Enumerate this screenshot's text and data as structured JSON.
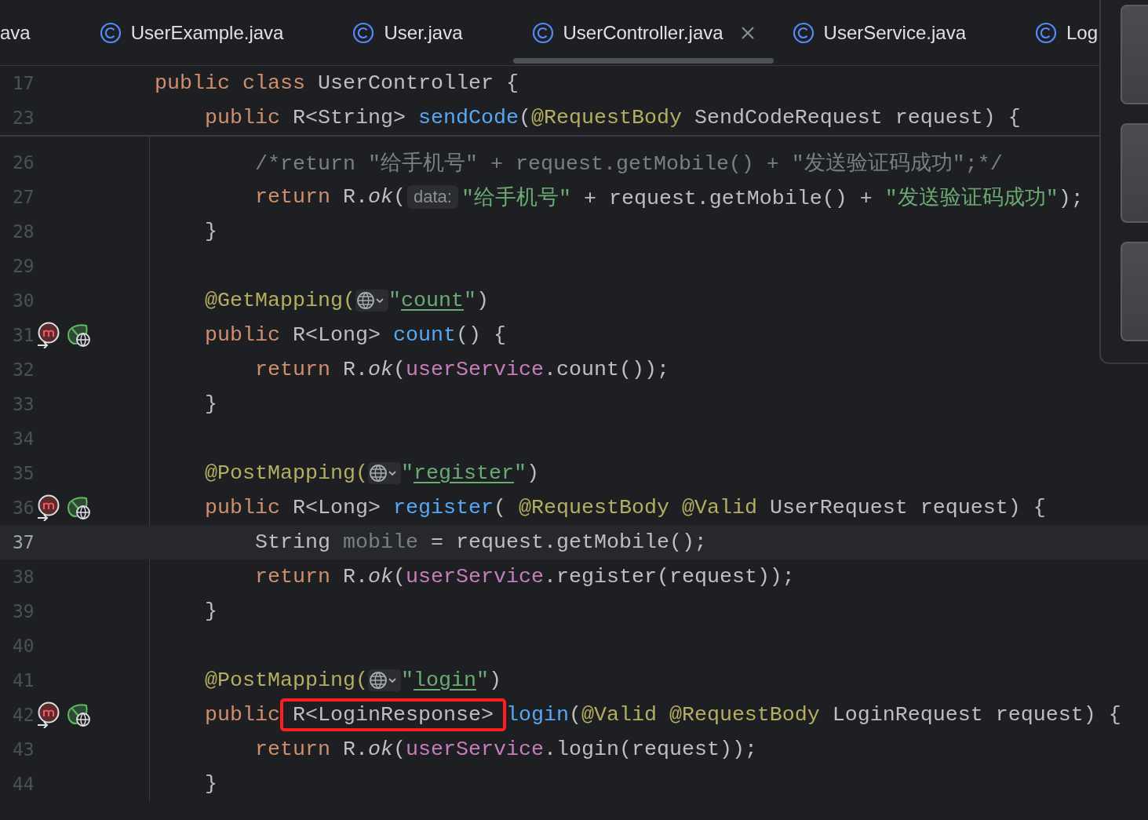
{
  "tabs": [
    {
      "label": "ava",
      "icon": false,
      "selected": false
    },
    {
      "label": "UserExample.java",
      "icon": true,
      "selected": false
    },
    {
      "label": "User.java",
      "icon": true,
      "selected": false
    },
    {
      "label": "UserController.java",
      "icon": true,
      "selected": true
    },
    {
      "label": "UserService.java",
      "icon": true,
      "selected": false
    },
    {
      "label": "Log",
      "icon": true,
      "selected": false
    }
  ],
  "sticky_lines": [
    {
      "number": "17",
      "tokens": [
        {
          "text": "public class ",
          "kind": "kw"
        },
        {
          "text": "UserController {",
          "kind": "plain"
        }
      ]
    },
    {
      "number": "23",
      "tokens": [
        {
          "text": "    public ",
          "kind": "kw"
        },
        {
          "text": "R<String> ",
          "kind": "plain"
        },
        {
          "text": "sendCode",
          "kind": "fn"
        },
        {
          "text": "(",
          "kind": "plain"
        },
        {
          "text": "@RequestBody",
          "kind": "ann"
        },
        {
          "text": " SendCodeRequest request) {",
          "kind": "plain"
        }
      ]
    }
  ],
  "lines": [
    {
      "number": "26",
      "current": false,
      "tokens": [
        {
          "text": "        /*return \"给手机号\" + request.getMobile() + \"发送验证码成功\";*/",
          "kind": "comment"
        }
      ]
    },
    {
      "number": "27",
      "current": false,
      "tokens": [
        {
          "text": "        return ",
          "kind": "kw"
        },
        {
          "text": "R.",
          "kind": "plain"
        },
        {
          "text": "ok",
          "kind": "italic"
        },
        {
          "text": "(",
          "kind": "plain"
        },
        {
          "text": "data:",
          "kind": "hint"
        },
        {
          "text": "\"给手机号\"",
          "kind": "str"
        },
        {
          "text": " + request.getMobile() + ",
          "kind": "plain"
        },
        {
          "text": "\"发送验证码成功\"",
          "kind": "str"
        },
        {
          "text": ");",
          "kind": "plain"
        }
      ]
    },
    {
      "number": "28",
      "current": false,
      "tokens": [
        {
          "text": "    }",
          "kind": "plain"
        }
      ]
    },
    {
      "number": "29",
      "current": false
    },
    {
      "number": "30",
      "current": false,
      "tokens": [
        {
          "text": "    @GetMapping(",
          "kind": "ann"
        },
        {
          "kind": "inlay"
        },
        {
          "text": "\"",
          "kind": "str"
        },
        {
          "text": "count",
          "kind": "url"
        },
        {
          "text": "\"",
          "kind": "str"
        },
        {
          "text": ")",
          "kind": "plain"
        }
      ]
    },
    {
      "number": "31",
      "current": false,
      "gutter": [
        {
          "kind": "method"
        },
        {
          "kind": "endpoint"
        }
      ],
      "tokens": [
        {
          "text": "    public ",
          "kind": "kw"
        },
        {
          "text": "R<Long> ",
          "kind": "plain"
        },
        {
          "text": "count",
          "kind": "fn"
        },
        {
          "text": "() {",
          "kind": "plain"
        }
      ]
    },
    {
      "number": "32",
      "current": false,
      "tokens": [
        {
          "text": "        return ",
          "kind": "kw"
        },
        {
          "text": "R.",
          "kind": "plain"
        },
        {
          "text": "ok",
          "kind": "italic"
        },
        {
          "text": "(",
          "kind": "plain"
        },
        {
          "text": "userService",
          "kind": "field"
        },
        {
          "text": ".count());",
          "kind": "plain"
        }
      ]
    },
    {
      "number": "33",
      "current": false,
      "tokens": [
        {
          "text": "    }",
          "kind": "plain"
        }
      ]
    },
    {
      "number": "34",
      "current": false
    },
    {
      "number": "35",
      "current": false,
      "tokens": [
        {
          "text": "    @PostMapping(",
          "kind": "ann"
        },
        {
          "kind": "inlay"
        },
        {
          "text": "\"",
          "kind": "str"
        },
        {
          "text": "register",
          "kind": "url"
        },
        {
          "text": "\"",
          "kind": "str"
        },
        {
          "text": ")",
          "kind": "plain"
        }
      ]
    },
    {
      "number": "36",
      "current": false,
      "gutter": [
        {
          "kind": "method"
        },
        {
          "kind": "endpoint"
        }
      ],
      "tokens": [
        {
          "text": "    public ",
          "kind": "kw"
        },
        {
          "text": "R<Long> ",
          "kind": "plain"
        },
        {
          "text": "register",
          "kind": "fn"
        },
        {
          "text": "( ",
          "kind": "plain"
        },
        {
          "text": "@RequestBody @Valid",
          "kind": "ann"
        },
        {
          "text": " UserRequest request) {",
          "kind": "plain"
        }
      ]
    },
    {
      "number": "37",
      "current": true,
      "tokens": [
        {
          "text": "        String ",
          "kind": "plain"
        },
        {
          "text": "mobile",
          "kind": "unused"
        },
        {
          "text": " = request.getMobile();",
          "kind": "plain"
        }
      ]
    },
    {
      "number": "38",
      "current": false,
      "tokens": [
        {
          "text": "        return ",
          "kind": "kw"
        },
        {
          "text": "R.",
          "kind": "plain"
        },
        {
          "text": "ok",
          "kind": "italic"
        },
        {
          "text": "(",
          "kind": "plain"
        },
        {
          "text": "userService",
          "kind": "field"
        },
        {
          "text": ".register(request));",
          "kind": "plain"
        }
      ]
    },
    {
      "number": "39",
      "current": false,
      "tokens": [
        {
          "text": "    }",
          "kind": "plain"
        }
      ]
    },
    {
      "number": "40",
      "current": false
    },
    {
      "number": "41",
      "current": false,
      "tokens": [
        {
          "text": "    @PostMapping(",
          "kind": "ann"
        },
        {
          "kind": "inlay"
        },
        {
          "text": "\"",
          "kind": "str"
        },
        {
          "text": "login",
          "kind": "url"
        },
        {
          "text": "\"",
          "kind": "str"
        },
        {
          "text": ")",
          "kind": "plain"
        }
      ]
    },
    {
      "number": "42",
      "current": false,
      "gutter": [
        {
          "kind": "method"
        },
        {
          "kind": "endpoint"
        }
      ],
      "tokens": [
        {
          "text": "    public",
          "kind": "kw"
        },
        {
          "text": "R<LoginResponse>",
          "kind": "boxed"
        },
        {
          "text": "login",
          "kind": "fn"
        },
        {
          "text": "(",
          "kind": "plain"
        },
        {
          "text": "@Valid @RequestBody",
          "kind": "ann"
        },
        {
          "text": " LoginRequest request) {",
          "kind": "plain"
        }
      ]
    },
    {
      "number": "43",
      "current": false,
      "tokens": [
        {
          "text": "        return ",
          "kind": "kw"
        },
        {
          "text": "R.",
          "kind": "plain"
        },
        {
          "text": "ok",
          "kind": "italic"
        },
        {
          "text": "(",
          "kind": "plain"
        },
        {
          "text": "userService",
          "kind": "field"
        },
        {
          "text": ".login(request));",
          "kind": "plain"
        }
      ]
    },
    {
      "number": "44",
      "current": false,
      "tokens": [
        {
          "text": "    }",
          "kind": "plain"
        }
      ]
    }
  ],
  "side_panel": {
    "cards": [
      {
        "kind": "preview"
      },
      {
        "kind": "preview"
      },
      {
        "kind": "preview"
      }
    ]
  }
}
